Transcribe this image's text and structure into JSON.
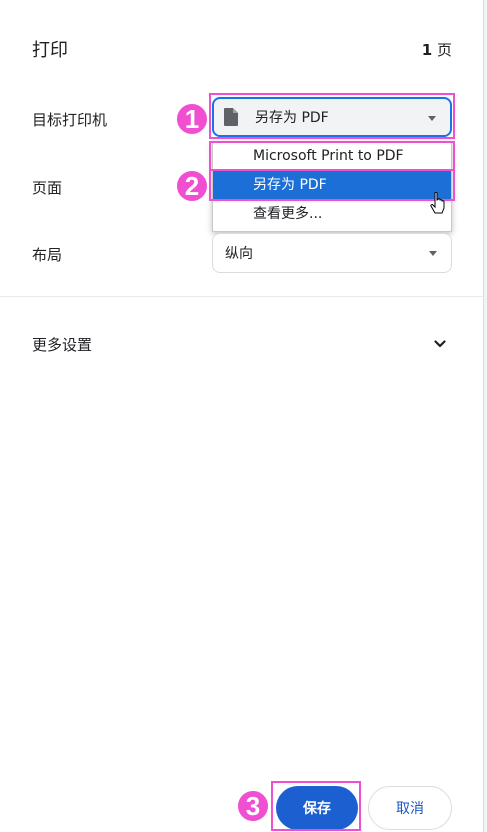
{
  "dialog": {
    "title": "打印",
    "page_count": "1",
    "page_unit": "页"
  },
  "destination": {
    "label": "目标打印机",
    "selected": "另存为 PDF",
    "icon": "document-icon",
    "options": [
      "Microsoft Print to PDF",
      "另存为 PDF",
      "查看更多..."
    ],
    "highlighted_index": 1
  },
  "pages_row": {
    "label": "页面"
  },
  "layout_row": {
    "label": "布局",
    "value": "纵向"
  },
  "more_settings": {
    "label": "更多设置",
    "icon": "chevron-down-icon"
  },
  "actions": {
    "save": "保存",
    "cancel": "取消"
  },
  "annotations": {
    "step1": "1",
    "step2": "2",
    "step3": "3",
    "color": "#f04fd2"
  },
  "colors": {
    "accent": "#1a73e8",
    "selected_option": "#1b6fd6",
    "primary_button": "#1b5fd0"
  }
}
